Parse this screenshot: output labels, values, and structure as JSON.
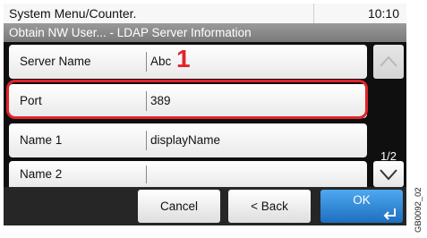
{
  "header": {
    "title": "System Menu/Counter.",
    "time": "10:10"
  },
  "breadcrumb": "Obtain NW User... - LDAP Server Information",
  "rows": [
    {
      "label": "Server Name",
      "value": "Abc"
    },
    {
      "label": "Port",
      "value": "389"
    },
    {
      "label": "Name 1",
      "value": "displayName"
    },
    {
      "label": "Name 2",
      "value": ""
    }
  ],
  "callout_number": "1",
  "pagination": "1/2",
  "buttons": {
    "cancel": "Cancel",
    "back": "< Back",
    "ok": "OK"
  },
  "document_code": "GB0092_02",
  "icons": {
    "scroll_up": "chevron-up-icon",
    "scroll_down": "chevron-down-icon",
    "ok_enter": "enter-icon"
  },
  "colors": {
    "highlight": "#e0242b",
    "ok_button": "#2a84d6"
  }
}
